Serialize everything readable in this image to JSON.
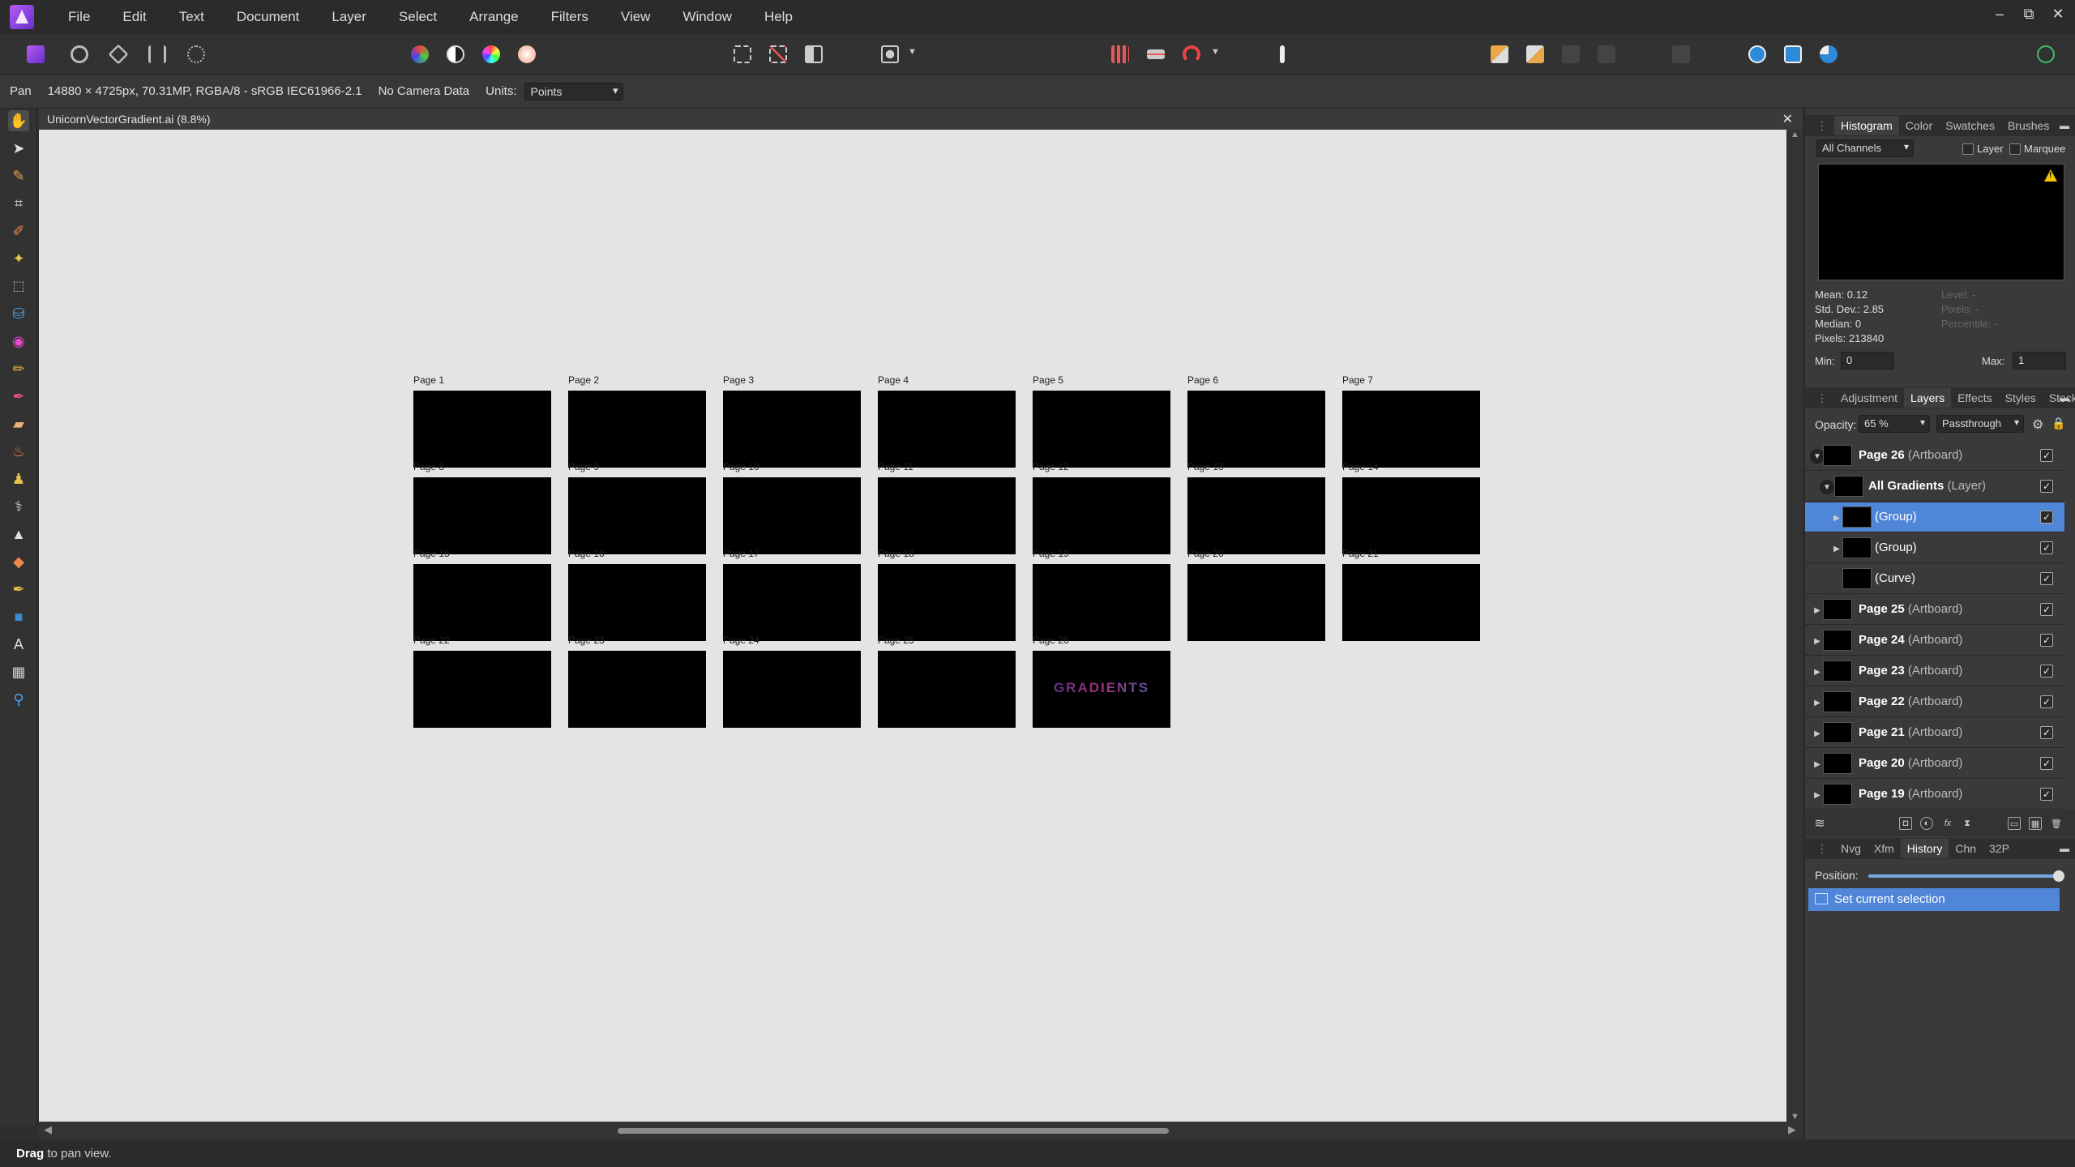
{
  "menubar": {
    "items": [
      "File",
      "Edit",
      "Text",
      "Document",
      "Layer",
      "Select",
      "Arrange",
      "Filters",
      "View",
      "Window",
      "Help"
    ],
    "window_controls": [
      "–",
      "⧉",
      "✕"
    ]
  },
  "context": {
    "tool_name": "Pan",
    "doc_info": "14880 × 4725px, 70.31MP, RGBA/8 - sRGB IEC61966-2.1",
    "camera": "No Camera Data",
    "units_label": "Units:",
    "units_value": "Points"
  },
  "document": {
    "tab_title": "UnicornVectorGradient.ai (8.8%)",
    "artboards": [
      {
        "label": "Page 1"
      },
      {
        "label": "Page 2"
      },
      {
        "label": "Page 3"
      },
      {
        "label": "Page 4"
      },
      {
        "label": "Page 5"
      },
      {
        "label": "Page 6"
      },
      {
        "label": "Page 7"
      },
      {
        "label": "Page 8"
      },
      {
        "label": "Page 9"
      },
      {
        "label": "Page 10"
      },
      {
        "label": "Page 11"
      },
      {
        "label": "Page 12"
      },
      {
        "label": "Page 13"
      },
      {
        "label": "Page 14"
      },
      {
        "label": "Page 15"
      },
      {
        "label": "Page 16"
      },
      {
        "label": "Page 17"
      },
      {
        "label": "Page 18"
      },
      {
        "label": "Page 19"
      },
      {
        "label": "Page 20"
      },
      {
        "label": "Page 21"
      },
      {
        "label": "Page 22"
      },
      {
        "label": "Page 23"
      },
      {
        "label": "Page 24"
      },
      {
        "label": "Page 25"
      },
      {
        "label": "Page 26",
        "content": "GRADIENTS"
      }
    ]
  },
  "histogram_panel": {
    "tabs": [
      "Histogram",
      "Color",
      "Swatches",
      "Brushes"
    ],
    "channels": "All Channels",
    "layer_label": "Layer",
    "marquee_label": "Marquee",
    "stats": [
      "Mean: 0.12",
      "Std. Dev.: 2.85",
      "Median: 0",
      "Pixels: 213840"
    ],
    "stats_dim": [
      "Level: -",
      "Pixels: -",
      "Percentile: -"
    ],
    "min_label": "Min:",
    "min_value": "0",
    "max_label": "Max:",
    "max_value": "1"
  },
  "layers_panel": {
    "tabs": [
      "Adjustment",
      "Layers",
      "Effects",
      "Styles",
      "Stock"
    ],
    "opacity_label": "Opacity:",
    "opacity_value": "65 %",
    "blend_mode": "Passthrough",
    "rows": [
      {
        "name": "Page 26",
        "type": "(Artboard)",
        "bold": true
      },
      {
        "name": "All Gradients",
        "type": "(Layer)",
        "bold": true
      },
      {
        "name": "",
        "type": "(Group)",
        "bold": false
      },
      {
        "name": "",
        "type": "(Group)",
        "bold": false
      },
      {
        "name": "",
        "type": "(Curve)",
        "bold": false
      },
      {
        "name": "Page 25",
        "type": "(Artboard)",
        "bold": true
      },
      {
        "name": "Page 24",
        "type": "(Artboard)",
        "bold": true
      },
      {
        "name": "Page 23",
        "type": "(Artboard)",
        "bold": true
      },
      {
        "name": "Page 22",
        "type": "(Artboard)",
        "bold": true
      },
      {
        "name": "Page 21",
        "type": "(Artboard)",
        "bold": true
      },
      {
        "name": "Page 20",
        "type": "(Artboard)",
        "bold": true
      },
      {
        "name": "Page 19",
        "type": "(Artboard)",
        "bold": true
      }
    ]
  },
  "history_panel": {
    "tabs": [
      "Nvg",
      "Xfm",
      "History",
      "Chn",
      "32P"
    ],
    "position_label": "Position:",
    "position_value": 1,
    "items": [
      "Set current selection"
    ]
  },
  "status": {
    "bold": "Drag",
    "text": " to pan view."
  }
}
